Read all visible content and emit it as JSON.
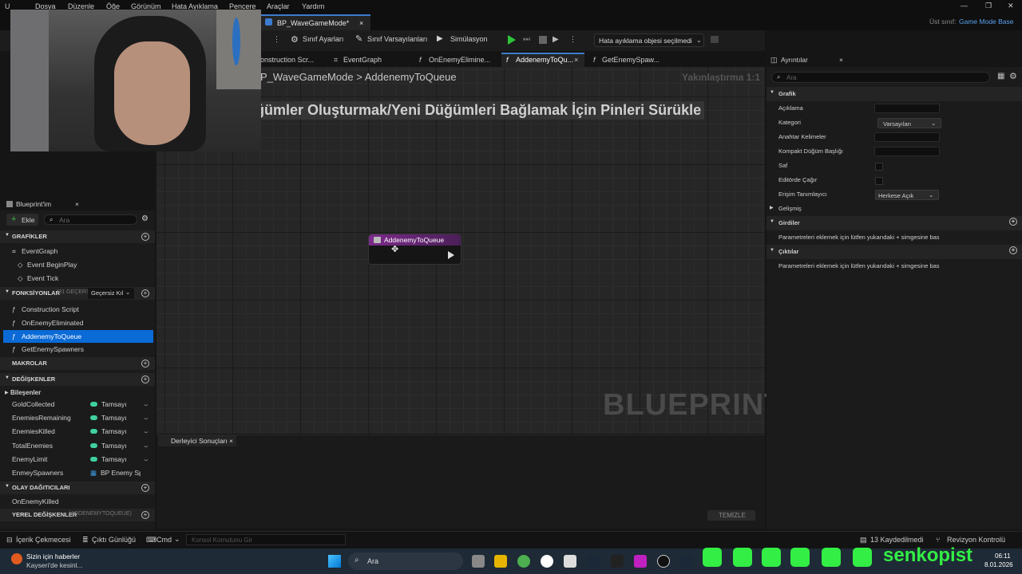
{
  "menu": [
    "Dosya",
    "Düzenle",
    "Öğe",
    "Görünüm",
    "Hata Ayıklama",
    "Pencere",
    "Araçlar",
    "Yardım"
  ],
  "logo": "U",
  "doc_tab": {
    "label": "BP_WaveGameMode*",
    "close": "×"
  },
  "parent_class": {
    "label": "Üst sınıf:",
    "value": "Game Mode Base"
  },
  "window_controls": [
    "—",
    "❐",
    "✕"
  ],
  "toolbar": {
    "class_settings": "Sınıf Ayarları",
    "class_defaults": "Sınıf Varsayılanları",
    "simulation": "Simülasyon",
    "debug_object": "Hata ayıklama objesi seçilmedi"
  },
  "subtabs": [
    "onstruction Scr...",
    "EventGraph",
    "OnEnemyElimine...",
    "AddenemyToQu...",
    "GetEnemySpaw..."
  ],
  "breadcrumb": {
    "parent": "P_WaveGameMode",
    "separator": ">",
    "current": "AddenemyToQueue"
  },
  "zoom": "Yakınlaştırma 1:1",
  "hint": "ğümler Oluşturmak/Yeni Düğümleri Bağlamak İçin Pinleri Sürükle",
  "watermark": "BLUEPRINT",
  "node": {
    "title": "AddenemyToQueue"
  },
  "compiler": {
    "tab": "Derleyici Sonuçları",
    "close": "×",
    "clear": "TEMİZLE"
  },
  "my_blueprint": {
    "tab": "Blueprint'im",
    "close": "×",
    "add": "Ekle",
    "search_placeholder": "Ara",
    "graphs_header": "GRAFİKLER",
    "event_graph": "EventGraph",
    "begin_play": "Event BeginPlay",
    "tick": "Event Tick",
    "functions_header": "FONKSİYONLAR",
    "functions_count": "(31 GEÇERSİ",
    "override": "Geçersiz Kıl",
    "functions": [
      "Construction Script",
      "OnEnemyEliminated",
      "AddenemyToQueue",
      "GetEnemySpawners"
    ],
    "macros_header": "MAKROLAR",
    "variables_header": "DEĞİŞKENLER",
    "components_header": "Bileşenler",
    "variables": [
      {
        "name": "GoldCollected",
        "type": "Tamsayı"
      },
      {
        "name": "EnemiesRemaining",
        "type": "Tamsayı"
      },
      {
        "name": "EnemiesKilled",
        "type": "Tamsayı"
      },
      {
        "name": "TotalEnemies",
        "type": "Tamsayı"
      },
      {
        "name": "EnemyLimit",
        "type": "Tamsayı"
      },
      {
        "name": "EnmeySpawners",
        "type": "BP Enemy Sp"
      }
    ],
    "dispatchers_header": "OLAY DAĞITICILARI",
    "dispatcher": "OnEnemyKilled",
    "locals_header": "YEREL DEĞİŞKENLER",
    "locals_sub": "(ADDENEMYTOQUEUE)"
  },
  "details": {
    "tab": "Ayrıntılar",
    "close": "×",
    "search_placeholder": "Ara",
    "graph_header": "Grafik",
    "description": "Açıklama",
    "category": "Kategori",
    "category_value": "Varsayılan",
    "keywords": "Anahtar Kelimeler",
    "compact_title": "Kompakt Düğüm Başlığı",
    "pure": "Saf",
    "call_in_editor": "Editörde Çağır",
    "access": "Erişim Tanımlayıcı",
    "access_value": "Herkese Açık",
    "advanced": "Gelişmiş",
    "inputs_header": "Girdiler",
    "inputs_hint": "Parametreleri eklemek için lütfen yukarıdaki + simgesine bas",
    "outputs_header": "Çıktılar",
    "outputs_hint": "Parametreleri eklemek için lütfen yukarıdaki + simgesine bas"
  },
  "statusbar": {
    "content_drawer": "İçerik Çekmecesi",
    "output_log": "Çıktı Günlüğü",
    "cmd": "Cmd",
    "console_placeholder": "Konsol Komutunu Gir",
    "saved": "13 Kaydedilmedi",
    "revision": "Revizyon Kontrolü"
  },
  "taskbar": {
    "news_title": "Sizin için haberler",
    "news_sub": "Kayseri'de kesinl...",
    "search": "Ara",
    "brand": "senkopist",
    "time": "06:11",
    "date": "8.01.2026"
  }
}
